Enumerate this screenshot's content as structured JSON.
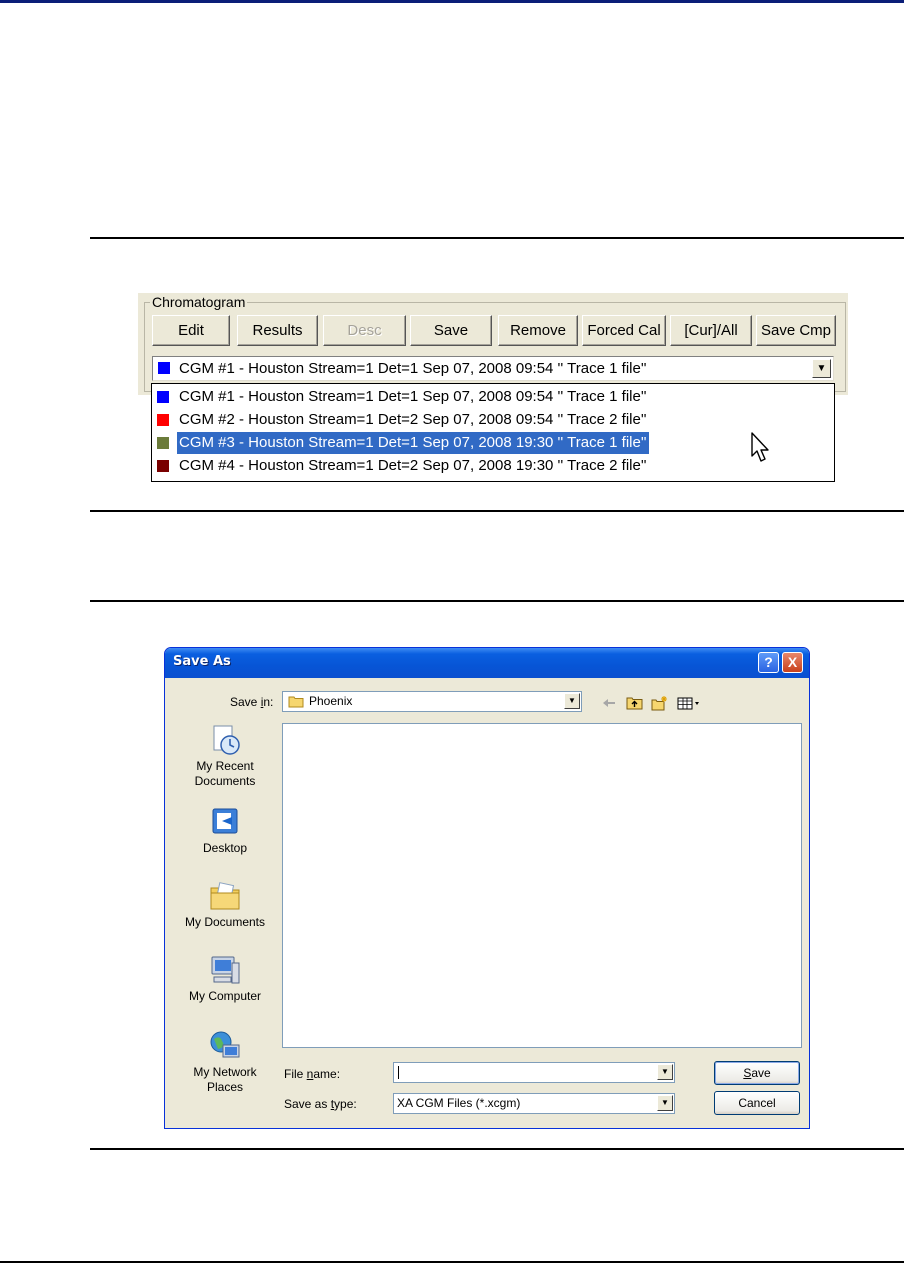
{
  "chromatogram": {
    "legend": "Chromatogram",
    "buttons": {
      "edit": "Edit",
      "results": "Results",
      "desc": "Desc",
      "save": "Save",
      "remove": "Remove",
      "forced_cal": "Forced Cal",
      "cur_all": "[Cur]/All",
      "save_cmp": "Save Cmp"
    },
    "selected": {
      "label": "CGM #1 - Houston Stream=1 Det=1 Sep 07, 2008 09:54 '' Trace 1 file''",
      "color": "#0000ff"
    },
    "options": [
      {
        "label": "CGM #1 - Houston Stream=1 Det=1 Sep 07, 2008 09:54 '' Trace 1 file''",
        "color": "#0000ff"
      },
      {
        "label": "CGM #2 - Houston Stream=1 Det=2 Sep 07, 2008 09:54 '' Trace 2 file''",
        "color": "#ff0000"
      },
      {
        "label": "CGM #3 - Houston Stream=1 Det=1 Sep 07, 2008 19:30 '' Trace 1 file''",
        "color": "#6b7b3a"
      },
      {
        "label": "CGM #4 - Houston Stream=1 Det=2 Sep 07, 2008 19:30 '' Trace 2 file''",
        "color": "#7a0000"
      }
    ],
    "highlighted_index": 2
  },
  "save_dialog": {
    "title": "Save As",
    "help_button": "?",
    "close_button": "X",
    "save_in_label_pre": "Save ",
    "save_in_label_key": "i",
    "save_in_label_post": "n:",
    "save_in_value": "Phoenix",
    "places": {
      "recent": "My Recent Documents",
      "desktop": "Desktop",
      "documents": "My Documents",
      "computer": "My Computer",
      "network": "My Network Places"
    },
    "file_name_label_pre": "File ",
    "file_name_label_key": "n",
    "file_name_label_post": "ame:",
    "file_name_value": "",
    "save_type_label_pre": "Save as ",
    "save_type_label_key": "t",
    "save_type_label_post": "ype:",
    "save_type_value": "XA CGM Files (*.xcgm)",
    "save_button_key": "S",
    "save_button_rest": "ave",
    "cancel_button": "Cancel"
  }
}
